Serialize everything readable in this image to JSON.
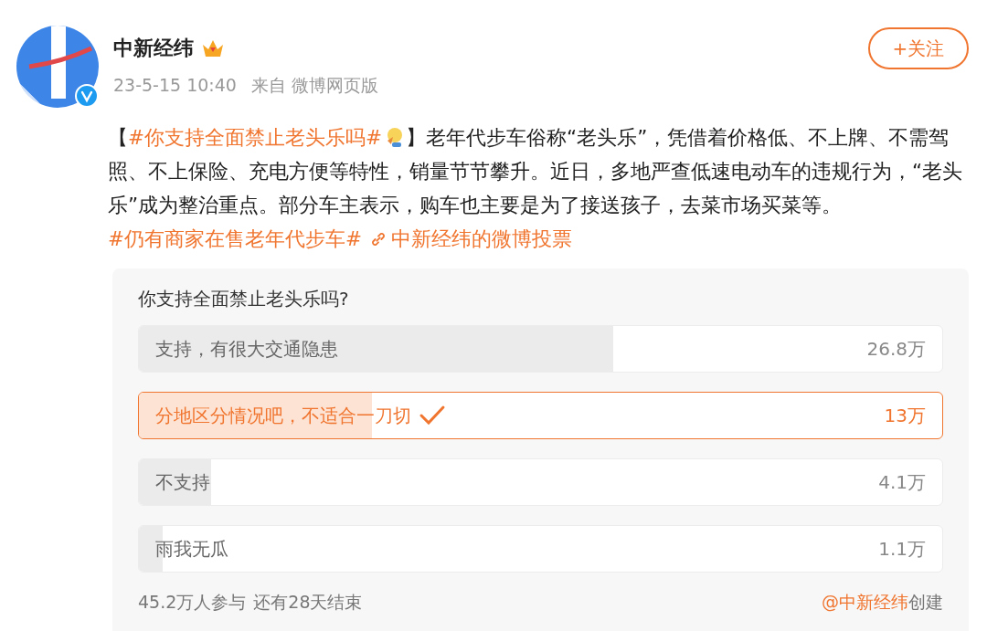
{
  "post": {
    "author": "中新经纬",
    "meta": "23-5-15 10:40",
    "source": "来自 微博网页版",
    "follow_button": "+关注",
    "segments": [
      {
        "kind": "text",
        "text": "【"
      },
      {
        "kind": "hashtag",
        "text": "#你支持全面禁止老头乐吗#"
      },
      {
        "kind": "text",
        "text": "】老年代步车俗称“老头乐”，凭借着价格低、不上牌、不需驾照、不上保险、充电方便等特性，销量节节攀升。近日，多地严查低速电动车的违规行为，“老头乐”成为整治重点。部分车主表示，购车也主要是为了接送孩子，去菜市场买菜等。"
      },
      {
        "kind": "hashtag",
        "text": "#仍有商家在售老年代步车#"
      },
      {
        "kind": "link",
        "text": "中新经纬的微博投票"
      }
    ]
  },
  "poll": {
    "question": "你支持全面禁止老头乐吗?",
    "options": [
      {
        "label": "支持，有很大交通隐患",
        "count": "26.8万",
        "level": 0.59,
        "selected": false
      },
      {
        "label": "分地区分情况吧，不适合一刀切",
        "count": "13万",
        "level": 0.29,
        "selected": true
      },
      {
        "label": "不支持",
        "count": "4.1万",
        "level": 0.09,
        "selected": false
      },
      {
        "label": "雨我无瓜",
        "count": "1.1万",
        "level": 0.03,
        "selected": false
      }
    ],
    "participants": "45.2万人参与",
    "remaining": "还有28天结束",
    "creator": "@中新经纬",
    "creator_suffix": "创建"
  }
}
